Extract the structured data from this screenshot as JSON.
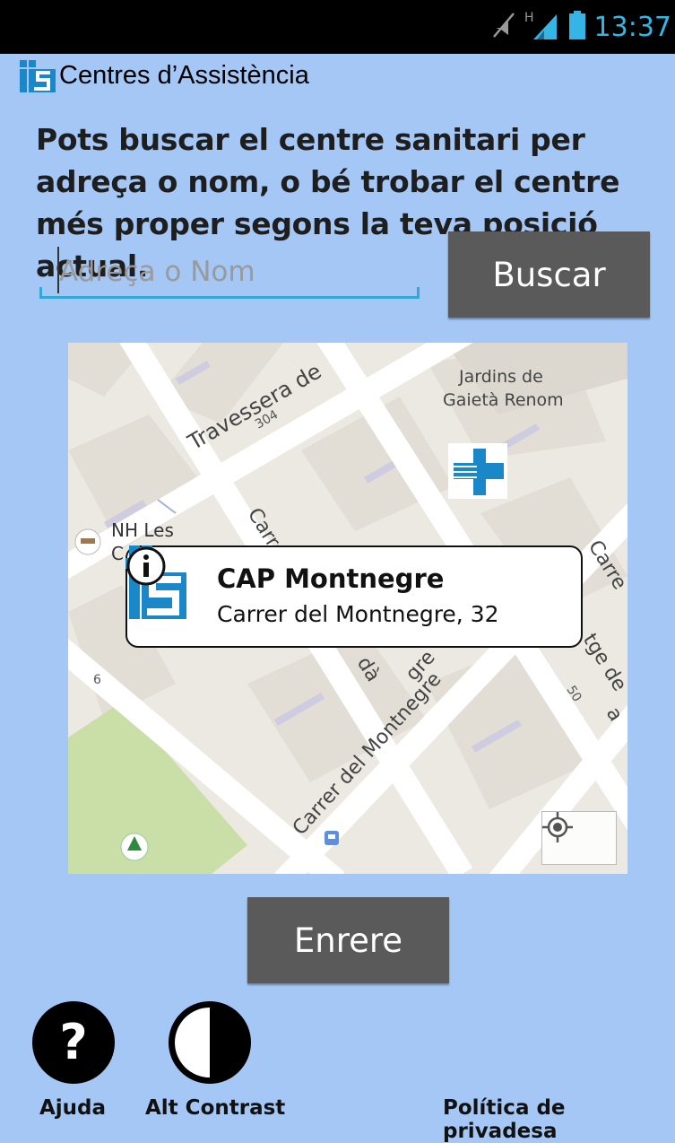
{
  "status": {
    "time": "13:37",
    "network": "H"
  },
  "app": {
    "title": "Centres d’Assistència"
  },
  "intro": {
    "text": "Pots buscar el centre sanitari per adreça o nom, o bé trobar el centre més proper segons la teva posició actual."
  },
  "search": {
    "placeholder": "Adreça o Nom",
    "value": "",
    "button": "Buscar"
  },
  "map": {
    "labels": {
      "park": "Jardins de\nGaietà Renom",
      "street1": "Travessera de",
      "number304": "304",
      "hotel": "NH Les",
      "hotel_c": "C",
      "carre1": "Carre",
      "carre2": "Carre",
      "montnegre": "Carrer del Montnegre",
      "frag_da": "dà",
      "frag_gre": "gre",
      "frag_num6": "6",
      "frag_50": "50",
      "frag_tge": "tge de",
      "frag_a": "a"
    },
    "popup": {
      "name": "CAP Montnegre",
      "address": "Carrer del Montnegre, 32"
    }
  },
  "back_button": "Enrere",
  "bottom": {
    "help_label": "Ajuda",
    "help_glyph": "?",
    "contrast_label": "Alt Contrast",
    "privacy_label": "Política de privadesa"
  },
  "colors": {
    "background": "#a4c7f5",
    "button": "#5a5a5a",
    "accent": "#33b5e5",
    "logo": "#1a87c9"
  }
}
